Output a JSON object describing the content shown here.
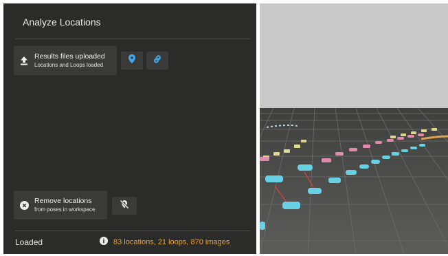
{
  "panel": {
    "title": "Analyze Locations",
    "upload_button": {
      "line1": "Results files uploaded",
      "line2": "Locations and Loops loaded",
      "icon": "upload-icon"
    },
    "location_pin_button": {
      "icon": "location-pin-icon"
    },
    "link_button": {
      "icon": "link-icon"
    },
    "remove_button": {
      "line1": "Remove locations",
      "line2": "from poses in workspace",
      "icon": "close-circle-icon"
    },
    "hide_location_button": {
      "icon": "location-off-icon"
    },
    "status": {
      "label": "Loaded",
      "summary": "83 locations, 21 loops, 870 images",
      "icon": "info-icon"
    }
  },
  "colors": {
    "panel_bg": "#2b2b2a",
    "button_bg": "#3a3a39",
    "accent_blue": "#3fa9f0",
    "status_orange": "#e3a33d",
    "sky": "#c9c9c9",
    "ground": "#595958"
  }
}
